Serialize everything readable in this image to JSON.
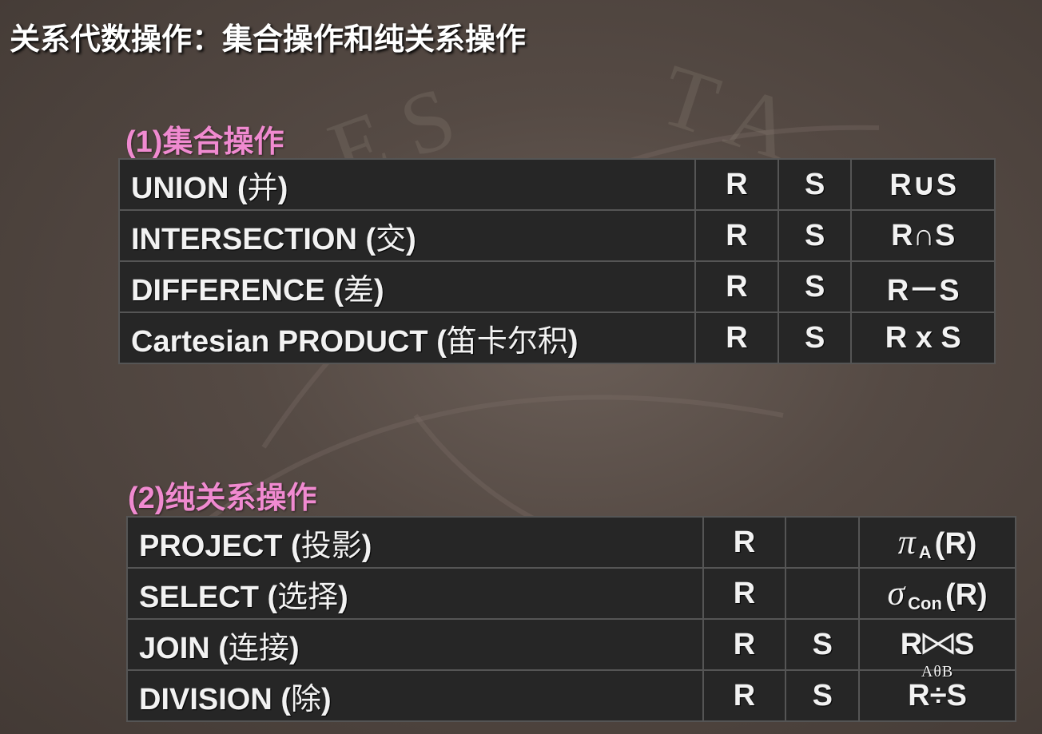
{
  "title": "关系代数操作：集合操作和纯关系操作",
  "set_ops": {
    "heading": "(1)集合操作",
    "rows": [
      {
        "name": "UNION",
        "zh": "并",
        "a": "R",
        "b": "S",
        "result": "R∪S"
      },
      {
        "name": "INTERSECTION",
        "zh": "交",
        "a": "R",
        "b": "S",
        "result": "R∩S"
      },
      {
        "name": "DIFFERENCE",
        "zh": "差",
        "a": "R",
        "b": "S",
        "result": "R－S"
      },
      {
        "name": "Cartesian PRODUCT",
        "zh": "笛卡尔积",
        "a": "R",
        "b": "S",
        "result": "R x S"
      }
    ]
  },
  "rel_ops": {
    "heading": "(2)纯关系操作",
    "project": {
      "name": "PROJECT",
      "zh": "投影",
      "a": "R",
      "b": "",
      "symbol": "π",
      "sub": "A",
      "arg": "(R)"
    },
    "select": {
      "name": "SELECT",
      "zh": "选择",
      "a": "R",
      "b": "",
      "symbol": "σ",
      "sub": "Con",
      "arg": "(R)"
    },
    "join": {
      "name": "JOIN",
      "zh": "连接",
      "a": "R",
      "b": "S",
      "left": "R",
      "right": "S",
      "sub": "AθB"
    },
    "division": {
      "name": "DIVISION",
      "zh": "除",
      "a": "R",
      "b": "S",
      "result": "R÷S"
    }
  }
}
